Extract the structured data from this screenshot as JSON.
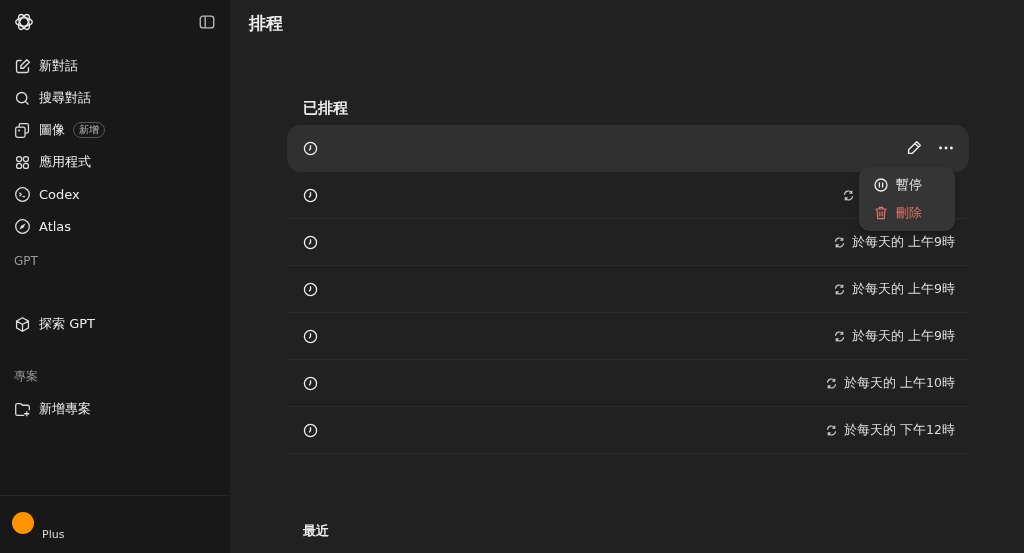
{
  "sidebar": {
    "items": [
      {
        "label": "新對話",
        "kind": "edit"
      },
      {
        "label": "搜尋對話",
        "kind": "search"
      },
      {
        "label": "圖像",
        "kind": "images",
        "badge": "新增"
      },
      {
        "label": "應用程式",
        "kind": "apps"
      },
      {
        "label": "Codex",
        "kind": "terminal"
      },
      {
        "label": "Atlas",
        "kind": "compass"
      }
    ],
    "gpt_heading": "GPT",
    "gpt_items": [
      {
        "label": "探索 GPT",
        "kind": "cube"
      }
    ],
    "projects_heading": "專案",
    "project_items": [
      {
        "label": "新增專案",
        "kind": "folder-plus"
      }
    ],
    "account": {
      "plan": "Plus"
    }
  },
  "page": {
    "title": "排程"
  },
  "scheduled": {
    "heading": "已排程",
    "rows": [
      {
        "selected": true
      },
      {
        "selected": false
      },
      {
        "selected": false,
        "schedule": "於每天的 上午9時"
      },
      {
        "selected": false,
        "schedule": "於每天的 上午9時"
      },
      {
        "selected": false,
        "schedule": "於每天的 上午9時"
      },
      {
        "selected": false,
        "schedule": "於每天的 上午10時"
      },
      {
        "selected": false,
        "schedule": "於每天的 下午12時"
      }
    ]
  },
  "menu": {
    "items": [
      {
        "label": "暫停",
        "kind": "pause"
      },
      {
        "label": "刪除",
        "kind": "delete"
      }
    ]
  },
  "recent": {
    "heading": "最近"
  }
}
